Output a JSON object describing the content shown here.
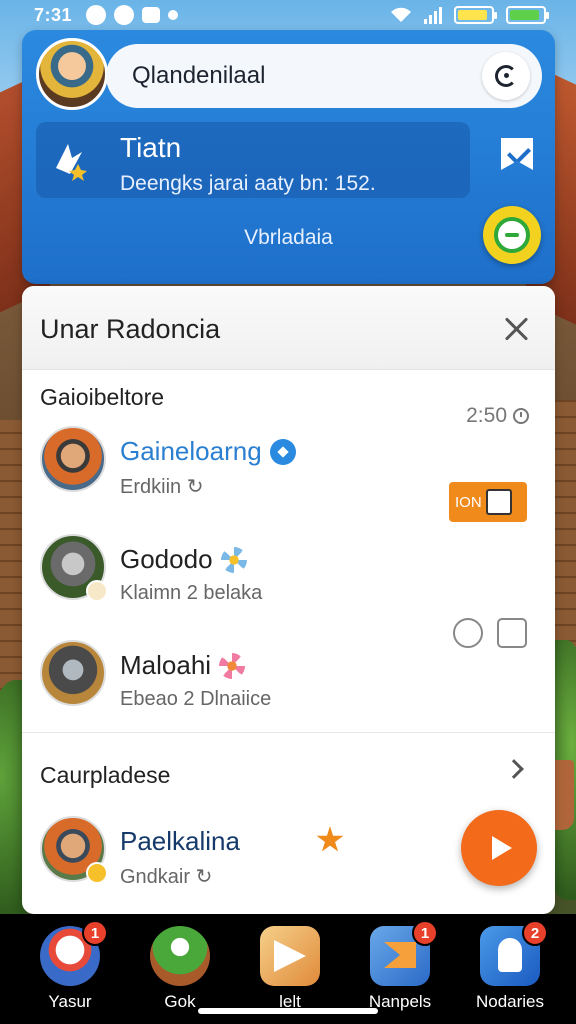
{
  "status_bar": {
    "time": "7:31",
    "battery_color": "#5fd04a"
  },
  "search": {
    "value": "Qlandenilaal"
  },
  "promo": {
    "title": "Tiatn",
    "subtitle": "Deengks jarai aaty bn: 152.",
    "link": "Vbrladaia"
  },
  "sheet": {
    "title": "Unar Radoncia",
    "section1_label": "Gaioibeltore",
    "section1_meta": "2:50",
    "contacts": [
      {
        "name": "Gaineloarng",
        "subtitle": "Erdkiin",
        "marker": "verified-icon"
      },
      {
        "name": "Gododo",
        "subtitle": "Klaimn 2 belaka",
        "marker": "flower-icon"
      },
      {
        "name": "Maloahi",
        "subtitle": "Ebeao 2 Dlnaiice",
        "marker": "flower-icon"
      }
    ],
    "tag_text": "ION",
    "section2_label": "Caurpladese",
    "featured": {
      "name": "Paelkalina",
      "subtitle": "Gndkair"
    }
  },
  "bottom_nav": [
    {
      "label": "Yasur",
      "badge": "1",
      "icon": "home-icon"
    },
    {
      "label": "Gok",
      "badge": "",
      "icon": "game-icon"
    },
    {
      "label": "lelt",
      "badge": "",
      "icon": "send-icon"
    },
    {
      "label": "Nanpels",
      "badge": "1",
      "icon": "mail-icon"
    },
    {
      "label": "Nodaries",
      "badge": "2",
      "icon": "profile-icon"
    }
  ],
  "colors": {
    "primary_blue": "#1e6fc9",
    "accent_orange": "#f26a1a",
    "verified_blue": "#2a8ae0",
    "badge_red": "#e8402a"
  }
}
